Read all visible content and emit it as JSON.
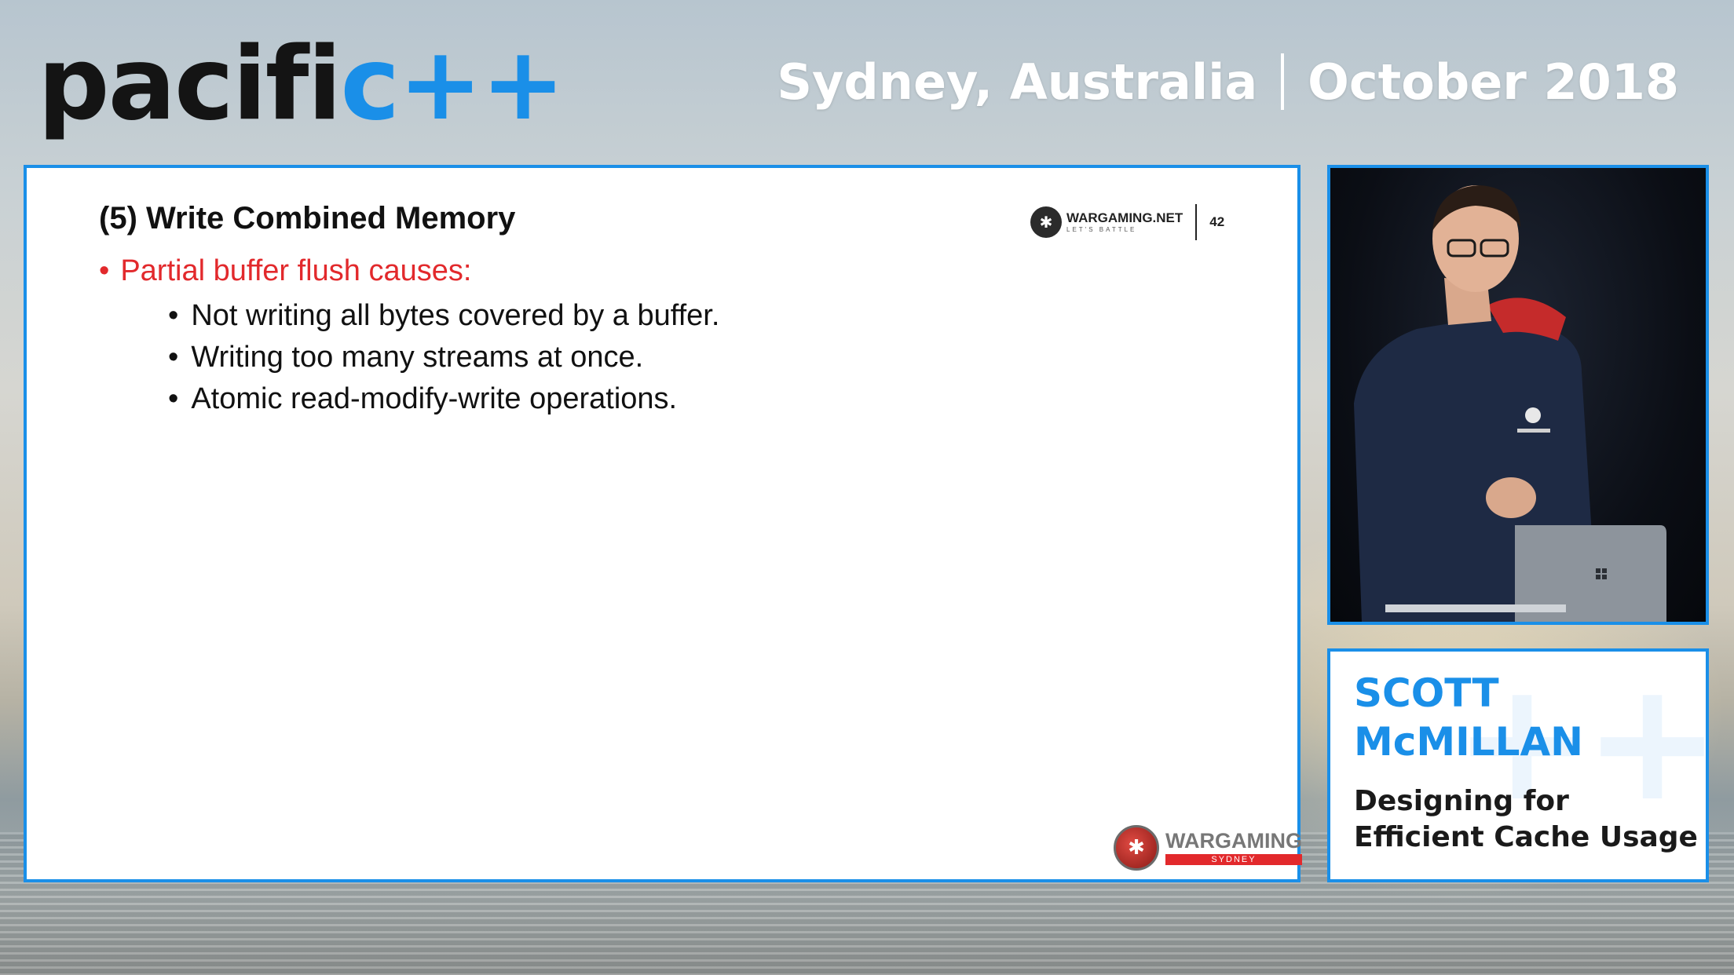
{
  "header": {
    "logo_part1": "pacifi",
    "logo_part2": "c++",
    "location": "Sydney, Australia",
    "date": "October 2018"
  },
  "slide": {
    "title": "(5) Write Combined Memory",
    "brand_name": "WARGAMING.NET",
    "brand_tagline": "LET'S BATTLE",
    "page_number": "42",
    "bullet": "Partial buffer flush causes:",
    "sub_bullets": [
      "Not writing all bytes covered by a buffer.",
      "Writing too many streams at once.",
      "Atomic read-modify-write operations."
    ],
    "footer_brand": "WARGAMING",
    "footer_city": "SYDNEY"
  },
  "speaker_card": {
    "first_name": "SCOTT",
    "last_name": "McMILLAN",
    "talk_title": "Designing for Efficient Cache Usage"
  },
  "colors": {
    "accent_blue": "#1a8fe8",
    "bullet_red": "#e2292c",
    "dark": "#141414"
  }
}
